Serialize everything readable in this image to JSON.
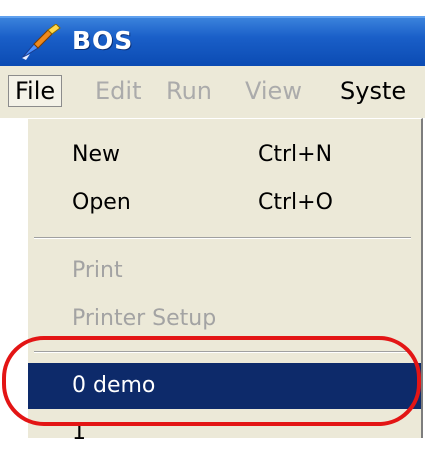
{
  "window": {
    "title": "BOS",
    "app_icon": "paint-brush-icon"
  },
  "menubar": {
    "items": [
      {
        "label": "File",
        "state": "open"
      },
      {
        "label": "Edit",
        "state": "disabled"
      },
      {
        "label": "Run",
        "state": "disabled"
      },
      {
        "label": "View",
        "state": "disabled"
      },
      {
        "label": "Syste",
        "state": "enabled"
      }
    ]
  },
  "file_menu": {
    "new_label": "New",
    "new_shortcut": "Ctrl+N",
    "open_label": "Open",
    "open_shortcut": "Ctrl+O",
    "print_label": "Print",
    "printer_setup_label": "Printer Setup",
    "recent_0_label": "0 demo",
    "recent_1_label": "1"
  },
  "colors": {
    "title_bar": "#0b4bb3",
    "menu_background": "#ece9d8",
    "selected_background": "#0d2a6a",
    "disabled_text": "#a3a3a3",
    "highlight_ring": "#e31515"
  }
}
